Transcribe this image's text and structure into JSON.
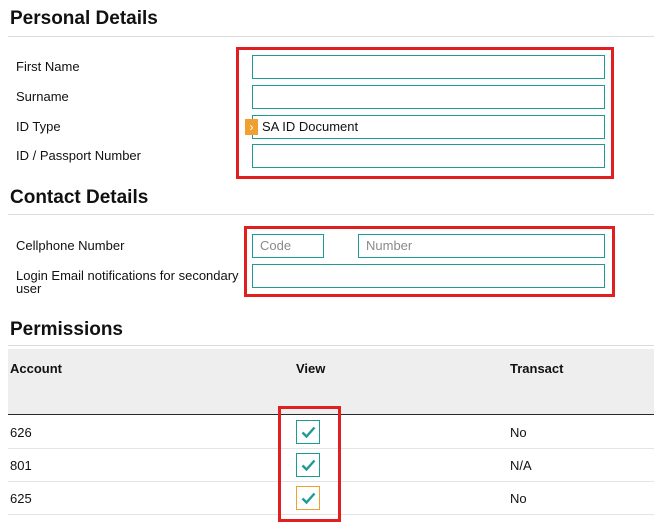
{
  "personal": {
    "title": "Personal Details",
    "first_name_label": "First Name",
    "first_name_value": "",
    "surname_label": "Surname",
    "surname_value": "",
    "id_type_label": "ID Type",
    "id_type_value": "SA ID Document",
    "id_number_label": "ID / Passport Number",
    "id_number_value": ""
  },
  "contact": {
    "title": "Contact Details",
    "cellphone_label": "Cellphone Number",
    "code_placeholder": "Code",
    "number_placeholder": "Number",
    "email_label_line1": "Login Email notifications for secondary",
    "email_label_line2": "user",
    "email_value": ""
  },
  "permissions": {
    "title": "Permissions",
    "headers": {
      "account": "Account",
      "view": "View",
      "transact": "Transact"
    },
    "rows": [
      {
        "account": "626",
        "view": true,
        "transact": "No"
      },
      {
        "account": "801",
        "view": true,
        "transact": "N/A"
      },
      {
        "account": "625",
        "view": true,
        "transact": "No"
      }
    ]
  },
  "colors": {
    "accent": "#1e9a95",
    "highlight": "#e02020",
    "select_arrow": "#f0a030"
  },
  "icons": {
    "select_arrow": "chevron-right-icon",
    "checkmark": "check-icon"
  }
}
